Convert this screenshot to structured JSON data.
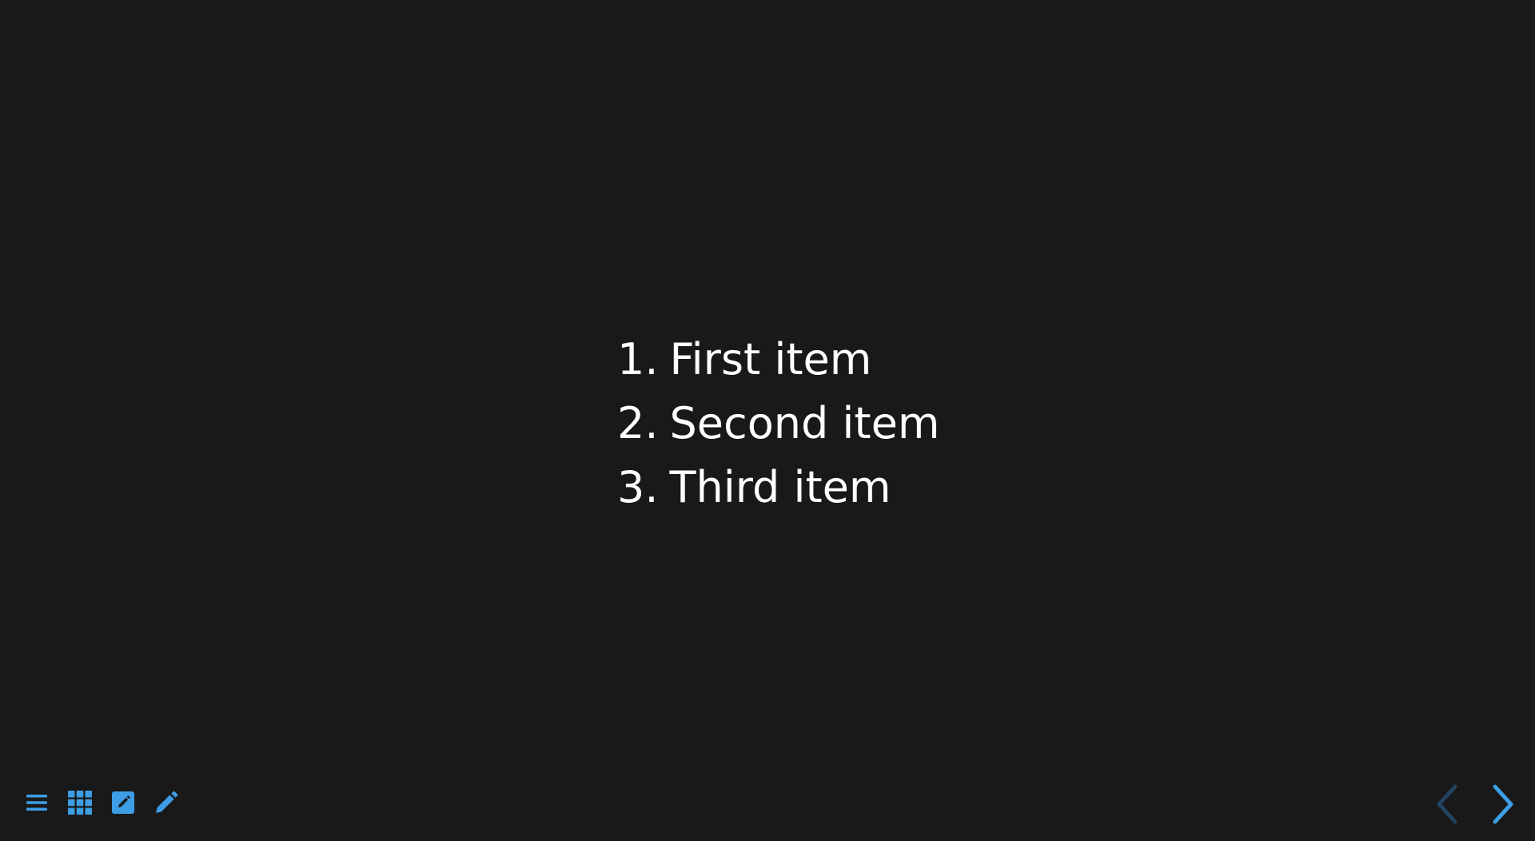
{
  "slide": {
    "list": [
      {
        "number": "1.",
        "text": "First item"
      },
      {
        "number": "2.",
        "text": "Second item"
      },
      {
        "number": "3.",
        "text": "Third item"
      }
    ]
  },
  "toolbar": {
    "icons": [
      "menu-icon",
      "grid-icon",
      "edit-note-icon",
      "pencil-icon"
    ]
  },
  "navigation": {
    "prev_icon": "chevron-left-icon",
    "next_icon": "chevron-right-icon"
  },
  "colors": {
    "background": "#191919",
    "text": "#ffffff",
    "accent": "#3d9ee5",
    "disabled": "#22435f"
  }
}
